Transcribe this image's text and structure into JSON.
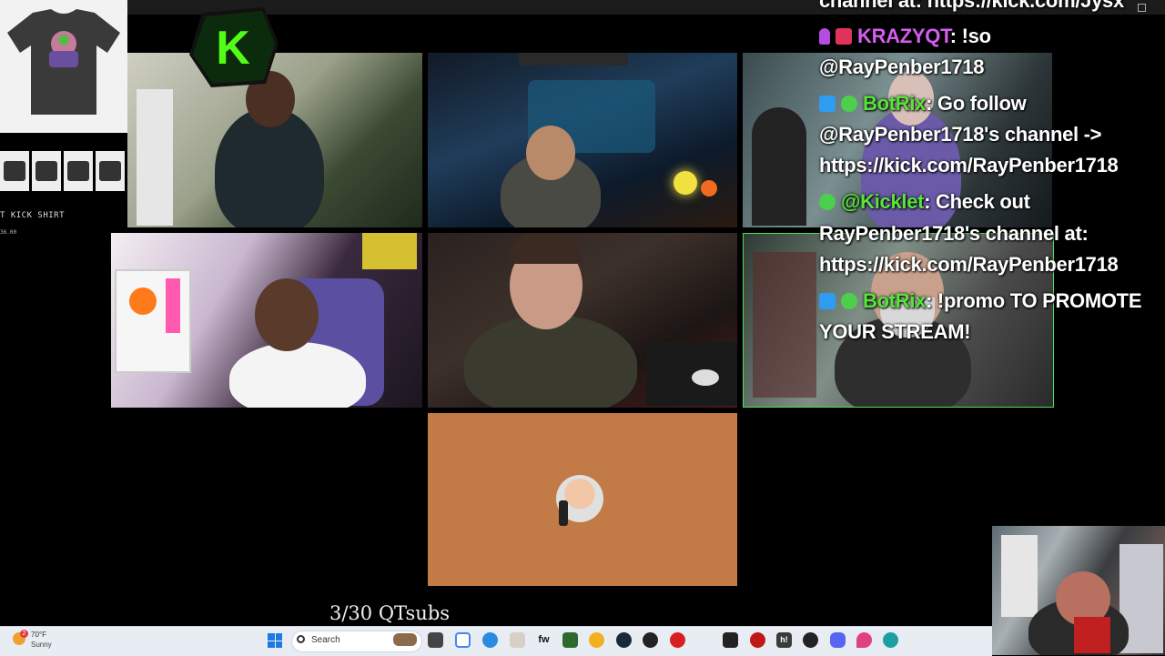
{
  "merch": {
    "title": "QT KICK SHIRT",
    "title_shown": "T KICK SHIRT",
    "price": "36.00",
    "thumbnails": 4
  },
  "chat": {
    "line0": "channel at: https://kick.com/Jysx",
    "messages": [
      {
        "user": "KRAZYQT",
        "text_a": ": !so",
        "text_b": "@RayPenber1718"
      },
      {
        "user": "BotRix",
        "text_a": ": Go follow",
        "text_b": "@RayPenber1718's channel ->",
        "text_c": "https://kick.com/RayPenber1718"
      },
      {
        "user": "@Kicklet",
        "text_a": ": Check out",
        "text_b": "RayPenber1718's channel at:",
        "text_c": "https://kick.com/RayPenber1718"
      },
      {
        "user": "BotRix",
        "text_a": ": !promo TO PROMOTE",
        "text_b": "YOUR STREAM!"
      }
    ]
  },
  "overlay": {
    "subs_counter": "3/30 QTsubs",
    "kick_logo_letter": "K"
  },
  "taskbar": {
    "weather_temp": "70°F",
    "weather_desc": "Sunny",
    "weather_badge": "2",
    "search_placeholder": "Search",
    "app_icons": [
      "file-explorer-icon",
      "chrome-icon",
      "edge-icon",
      "cat-app-icon",
      "fw-icon",
      "xbox-icon",
      "star-app-icon",
      "steam-icon",
      "obs-icon",
      "red-app-icon",
      "grid-app-icon",
      "record-icon",
      "h-app-icon",
      "openai-icon",
      "discord-icon",
      "location-icon",
      "edge-dev-icon"
    ],
    "fw_label": "fw",
    "h_label": "h!"
  },
  "colors": {
    "kick_green": "#53fc18",
    "krazy_name": "#d65cf0",
    "bot_name": "#58e43b",
    "taskbar_bg": "#e8edf3"
  }
}
